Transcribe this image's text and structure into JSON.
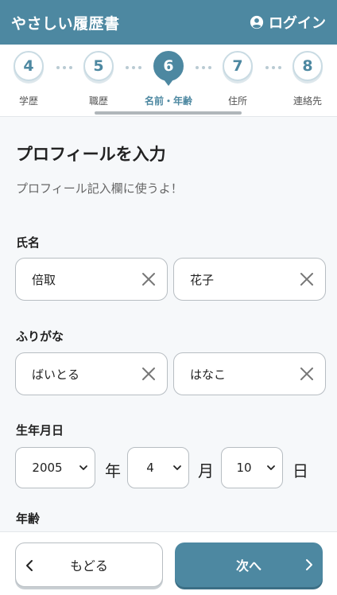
{
  "header": {
    "app_title": "やさしい履歴書",
    "login_label": "ログイン",
    "login_icon": "user-circle-icon"
  },
  "stepper": {
    "steps": [
      {
        "number": "4",
        "label": "学歴"
      },
      {
        "number": "5",
        "label": "職歴"
      },
      {
        "number": "6",
        "label": "名前・年齢"
      },
      {
        "number": "7",
        "label": "住所"
      },
      {
        "number": "8",
        "label": "連絡先"
      }
    ],
    "active_step": "6"
  },
  "page": {
    "title": "プロフィールを入力",
    "subtitle": "プロフィール記入欄に使うよ！"
  },
  "name_section": {
    "label": "氏名",
    "last_name": "倍取",
    "first_name": "花子"
  },
  "furigana_section": {
    "label": "ふりがな",
    "last_name": "ばいとる",
    "first_name": "はなこ"
  },
  "birthdate_section": {
    "label": "生年月日",
    "year": "2005",
    "year_unit": "年",
    "month": "4",
    "month_unit": "月",
    "day": "10",
    "day_unit": "日"
  },
  "age_section": {
    "label": "年齢"
  },
  "footer": {
    "back_label": "もどる",
    "next_label": "次へ"
  },
  "colors": {
    "accent": "#4d88a1",
    "border": "#b7bdc2",
    "background": "#f6f8fa"
  }
}
